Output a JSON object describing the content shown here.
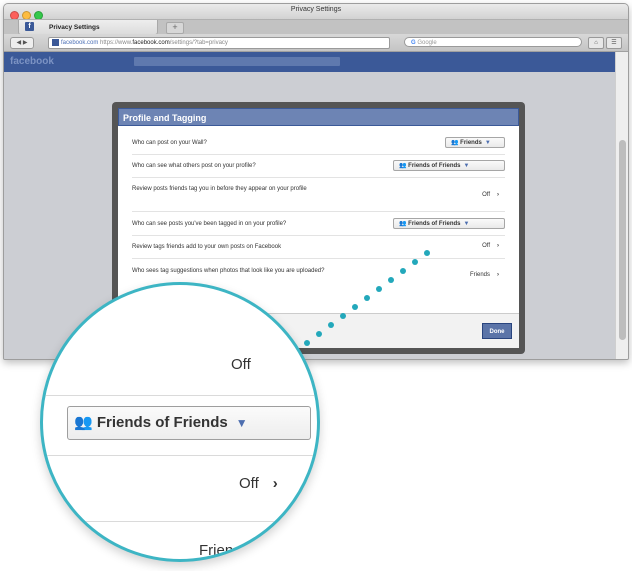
{
  "window": {
    "title": "Privacy Settings"
  },
  "tab": {
    "label": "Privacy Settings",
    "new_tab": "+"
  },
  "toolbar": {
    "url_domain": "facebook.com",
    "url_prefix": "https://www.",
    "url_host": "facebook.com",
    "url_path": "/settings/?tab=privacy",
    "search_placeholder": "Google"
  },
  "facebook": {
    "logo": "facebook"
  },
  "dialog": {
    "title": "Profile and Tagging",
    "rows": [
      {
        "question": "Who can post on your Wall?",
        "control": "select",
        "value": "Friends",
        "icon": "friends-icon"
      },
      {
        "question": "Who can see what others post on your profile?",
        "control": "select",
        "value": "Friends of Friends",
        "icon": "friends-of-friends-icon"
      },
      {
        "question": "Review posts friends tag you in before they appear on your profile",
        "control": "toggle",
        "value": "Off"
      },
      {
        "question": "Who can see posts you've been tagged in on your profile?",
        "control": "select",
        "value": "Friends of Friends",
        "icon": "friends-of-friends-icon"
      },
      {
        "question": "Review tags friends add to your own posts on Facebook",
        "control": "toggle",
        "value": "Off"
      },
      {
        "question": "Who sees tag suggestions when photos that look like you are uploaded?",
        "control": "toggle",
        "value": "Friends"
      }
    ],
    "done_label": "Done"
  },
  "magnifier": {
    "off_top": "Off",
    "select_value": "Friends of Friends",
    "off_bottom": "Off",
    "friends_partial": "Frien"
  },
  "colors": {
    "facebook_blue": "#3b5998",
    "accent_teal": "#3db5c4",
    "dialog_header": "#6d84b4"
  }
}
